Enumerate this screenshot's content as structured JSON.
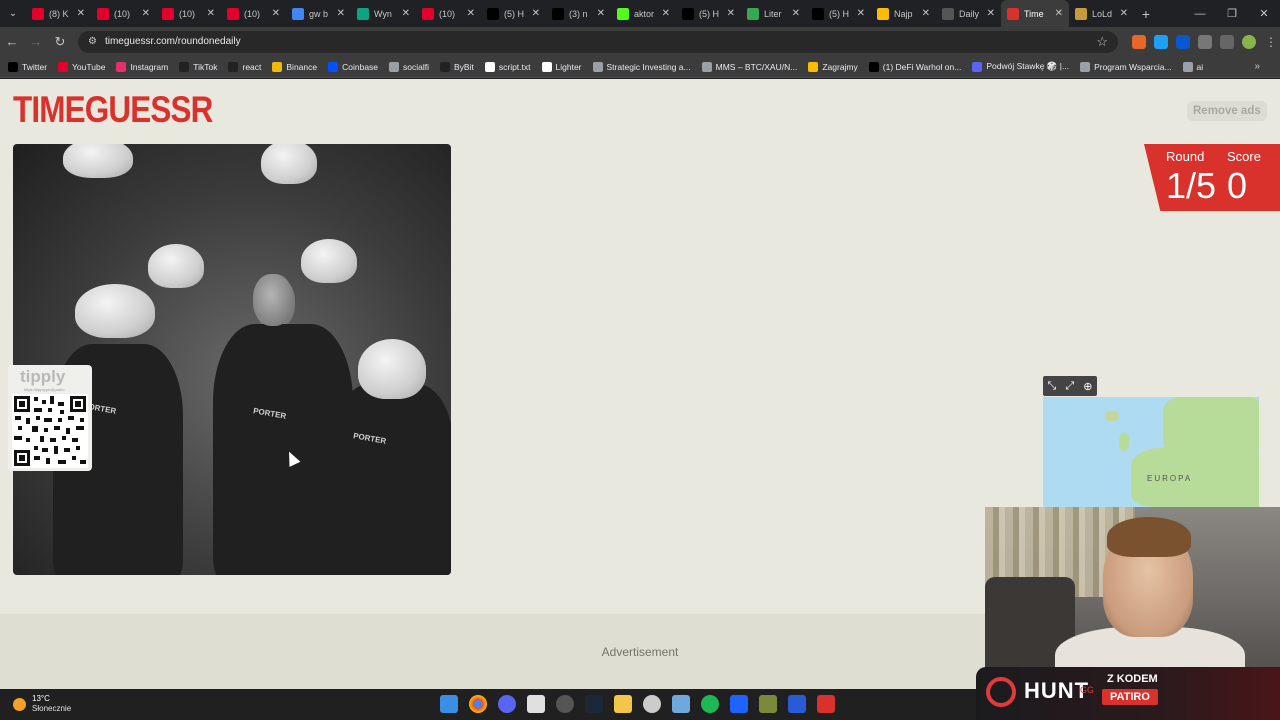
{
  "browser": {
    "tabs": [
      {
        "title": "(8) K",
        "icon": "youtube-icon",
        "color": "#e4002b"
      },
      {
        "title": "(10) ",
        "icon": "youtube-icon",
        "color": "#e4002b"
      },
      {
        "title": "(10) ",
        "icon": "youtube-icon",
        "color": "#e4002b"
      },
      {
        "title": "(10) ",
        "icon": "youtube-icon",
        "color": "#e4002b"
      },
      {
        "title": "gw b",
        "icon": "google-icon",
        "color": "#4285f4"
      },
      {
        "title": "Wyn",
        "icon": "chatgpt-icon",
        "color": "#10a37f"
      },
      {
        "title": "(10) ",
        "icon": "youtube-icon",
        "color": "#e4002b"
      },
      {
        "title": "(5) H",
        "icon": "x-icon",
        "color": "#000000"
      },
      {
        "title": "(3) n",
        "icon": "x-icon",
        "color": "#000000"
      },
      {
        "title": "aktor",
        "icon": "kick-icon",
        "color": "#53fc18"
      },
      {
        "title": "(5) H",
        "icon": "x-icon",
        "color": "#000000"
      },
      {
        "title": "Liter",
        "icon": "literal-icon",
        "color": "#34a853"
      },
      {
        "title": "(5) H",
        "icon": "x-icon",
        "color": "#000000"
      },
      {
        "title": "Najp",
        "icon": "tag-icon",
        "color": "#fbbc04"
      },
      {
        "title": "Daily",
        "icon": "daily-icon",
        "color": "#555555"
      },
      {
        "title": "Time",
        "icon": "timeguessr-icon",
        "color": "#d9312c",
        "active": true
      },
      {
        "title": "LoLd",
        "icon": "lol-icon",
        "color": "#c89b3c"
      }
    ],
    "url": "timeguessr.com/roundonedaily",
    "bookmarks": [
      {
        "label": "Twitter",
        "icon": "x-icon",
        "color": "#000000"
      },
      {
        "label": "YouTube",
        "icon": "youtube-icon",
        "color": "#e4002b"
      },
      {
        "label": "Instagram",
        "icon": "instagram-icon",
        "color": "#e1306c"
      },
      {
        "label": "TikTok",
        "icon": "tiktok-icon",
        "color": "#222222"
      },
      {
        "label": "react",
        "icon": "tiktok-icon",
        "color": "#222222"
      },
      {
        "label": "Binance",
        "icon": "binance-icon",
        "color": "#f0b90b"
      },
      {
        "label": "Coinbase",
        "icon": "coinbase-icon",
        "color": "#0052ff"
      },
      {
        "label": "socialfi",
        "icon": "folder-icon",
        "color": "#9aa0a6"
      },
      {
        "label": "ByBit",
        "icon": "bybit-icon",
        "color": "#222222"
      },
      {
        "label": "script.txt",
        "icon": "github-icon",
        "color": "#ffffff"
      },
      {
        "label": "Lighter",
        "icon": "lighter-icon",
        "color": "#ffffff"
      },
      {
        "label": "Strategic Investing a...",
        "icon": "loading-icon",
        "color": "#9aa0a6"
      },
      {
        "label": "MMS – BTC/XAU/N...",
        "icon": "globe-icon",
        "color": "#9aa0a6"
      },
      {
        "label": "Zagrajmy",
        "icon": "user-icon",
        "color": "#fbbc04"
      },
      {
        "label": "(1) DeFi Warhol on...",
        "icon": "x-icon",
        "color": "#000000"
      },
      {
        "label": "Podwój Stawkę 🎲 |...",
        "icon": "discord-icon",
        "color": "#5865f2"
      },
      {
        "label": "Program Wsparcia...",
        "icon": "bookmark-icon",
        "color": "#9aa0a6"
      },
      {
        "label": "ai",
        "icon": "folder-icon",
        "color": "#9aa0a6"
      }
    ]
  },
  "page": {
    "logo": "TIMEGUESSR",
    "remove_ads": "Remove ads",
    "round_label": "Round",
    "round_value": "1/5",
    "score_label": "Score",
    "score_value": "0",
    "photo_text": "PORTER",
    "map_label": "EUROPA",
    "advertisement": "Advertisement",
    "tipply_logo": "tipply",
    "tipply_url": "https://tipply.pl/@patiro"
  },
  "overlay": {
    "hunt_text": "HUNT",
    "hunt_gg": "GG",
    "promo_line": "Z KODEM",
    "promo_code": "PATIRO"
  },
  "taskbar": {
    "temperature": "13°C",
    "weather": "Słonecznie"
  },
  "colors": {
    "brand_red": "#d9312c",
    "page_bg": "#e9e8de"
  }
}
